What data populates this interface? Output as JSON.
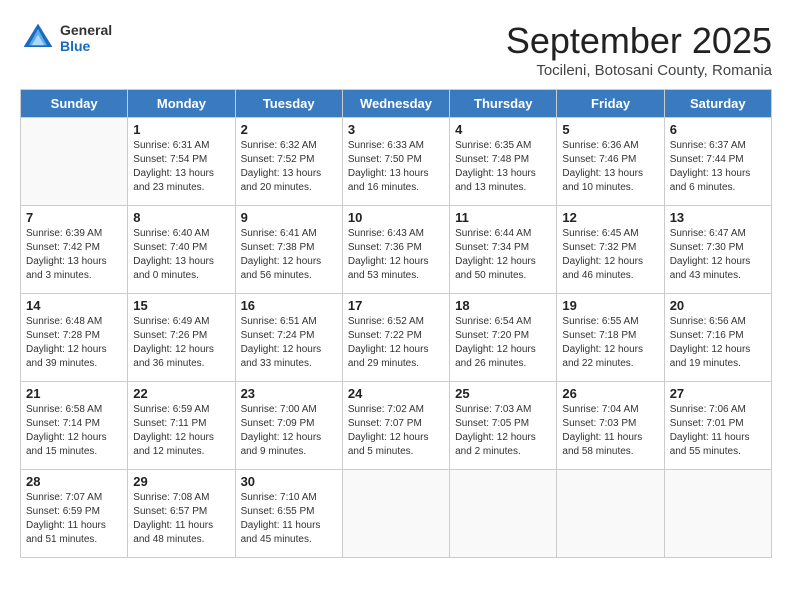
{
  "header": {
    "logo_general": "General",
    "logo_blue": "Blue",
    "month": "September 2025",
    "location": "Tocileni, Botosani County, Romania"
  },
  "days_of_week": [
    "Sunday",
    "Monday",
    "Tuesday",
    "Wednesday",
    "Thursday",
    "Friday",
    "Saturday"
  ],
  "weeks": [
    [
      {
        "day": "",
        "info": ""
      },
      {
        "day": "1",
        "info": "Sunrise: 6:31 AM\nSunset: 7:54 PM\nDaylight: 13 hours\nand 23 minutes."
      },
      {
        "day": "2",
        "info": "Sunrise: 6:32 AM\nSunset: 7:52 PM\nDaylight: 13 hours\nand 20 minutes."
      },
      {
        "day": "3",
        "info": "Sunrise: 6:33 AM\nSunset: 7:50 PM\nDaylight: 13 hours\nand 16 minutes."
      },
      {
        "day": "4",
        "info": "Sunrise: 6:35 AM\nSunset: 7:48 PM\nDaylight: 13 hours\nand 13 minutes."
      },
      {
        "day": "5",
        "info": "Sunrise: 6:36 AM\nSunset: 7:46 PM\nDaylight: 13 hours\nand 10 minutes."
      },
      {
        "day": "6",
        "info": "Sunrise: 6:37 AM\nSunset: 7:44 PM\nDaylight: 13 hours\nand 6 minutes."
      }
    ],
    [
      {
        "day": "7",
        "info": "Sunrise: 6:39 AM\nSunset: 7:42 PM\nDaylight: 13 hours\nand 3 minutes."
      },
      {
        "day": "8",
        "info": "Sunrise: 6:40 AM\nSunset: 7:40 PM\nDaylight: 13 hours\nand 0 minutes."
      },
      {
        "day": "9",
        "info": "Sunrise: 6:41 AM\nSunset: 7:38 PM\nDaylight: 12 hours\nand 56 minutes."
      },
      {
        "day": "10",
        "info": "Sunrise: 6:43 AM\nSunset: 7:36 PM\nDaylight: 12 hours\nand 53 minutes."
      },
      {
        "day": "11",
        "info": "Sunrise: 6:44 AM\nSunset: 7:34 PM\nDaylight: 12 hours\nand 50 minutes."
      },
      {
        "day": "12",
        "info": "Sunrise: 6:45 AM\nSunset: 7:32 PM\nDaylight: 12 hours\nand 46 minutes."
      },
      {
        "day": "13",
        "info": "Sunrise: 6:47 AM\nSunset: 7:30 PM\nDaylight: 12 hours\nand 43 minutes."
      }
    ],
    [
      {
        "day": "14",
        "info": "Sunrise: 6:48 AM\nSunset: 7:28 PM\nDaylight: 12 hours\nand 39 minutes."
      },
      {
        "day": "15",
        "info": "Sunrise: 6:49 AM\nSunset: 7:26 PM\nDaylight: 12 hours\nand 36 minutes."
      },
      {
        "day": "16",
        "info": "Sunrise: 6:51 AM\nSunset: 7:24 PM\nDaylight: 12 hours\nand 33 minutes."
      },
      {
        "day": "17",
        "info": "Sunrise: 6:52 AM\nSunset: 7:22 PM\nDaylight: 12 hours\nand 29 minutes."
      },
      {
        "day": "18",
        "info": "Sunrise: 6:54 AM\nSunset: 7:20 PM\nDaylight: 12 hours\nand 26 minutes."
      },
      {
        "day": "19",
        "info": "Sunrise: 6:55 AM\nSunset: 7:18 PM\nDaylight: 12 hours\nand 22 minutes."
      },
      {
        "day": "20",
        "info": "Sunrise: 6:56 AM\nSunset: 7:16 PM\nDaylight: 12 hours\nand 19 minutes."
      }
    ],
    [
      {
        "day": "21",
        "info": "Sunrise: 6:58 AM\nSunset: 7:14 PM\nDaylight: 12 hours\nand 15 minutes."
      },
      {
        "day": "22",
        "info": "Sunrise: 6:59 AM\nSunset: 7:11 PM\nDaylight: 12 hours\nand 12 minutes."
      },
      {
        "day": "23",
        "info": "Sunrise: 7:00 AM\nSunset: 7:09 PM\nDaylight: 12 hours\nand 9 minutes."
      },
      {
        "day": "24",
        "info": "Sunrise: 7:02 AM\nSunset: 7:07 PM\nDaylight: 12 hours\nand 5 minutes."
      },
      {
        "day": "25",
        "info": "Sunrise: 7:03 AM\nSunset: 7:05 PM\nDaylight: 12 hours\nand 2 minutes."
      },
      {
        "day": "26",
        "info": "Sunrise: 7:04 AM\nSunset: 7:03 PM\nDaylight: 11 hours\nand 58 minutes."
      },
      {
        "day": "27",
        "info": "Sunrise: 7:06 AM\nSunset: 7:01 PM\nDaylight: 11 hours\nand 55 minutes."
      }
    ],
    [
      {
        "day": "28",
        "info": "Sunrise: 7:07 AM\nSunset: 6:59 PM\nDaylight: 11 hours\nand 51 minutes."
      },
      {
        "day": "29",
        "info": "Sunrise: 7:08 AM\nSunset: 6:57 PM\nDaylight: 11 hours\nand 48 minutes."
      },
      {
        "day": "30",
        "info": "Sunrise: 7:10 AM\nSunset: 6:55 PM\nDaylight: 11 hours\nand 45 minutes."
      },
      {
        "day": "",
        "info": ""
      },
      {
        "day": "",
        "info": ""
      },
      {
        "day": "",
        "info": ""
      },
      {
        "day": "",
        "info": ""
      }
    ]
  ]
}
